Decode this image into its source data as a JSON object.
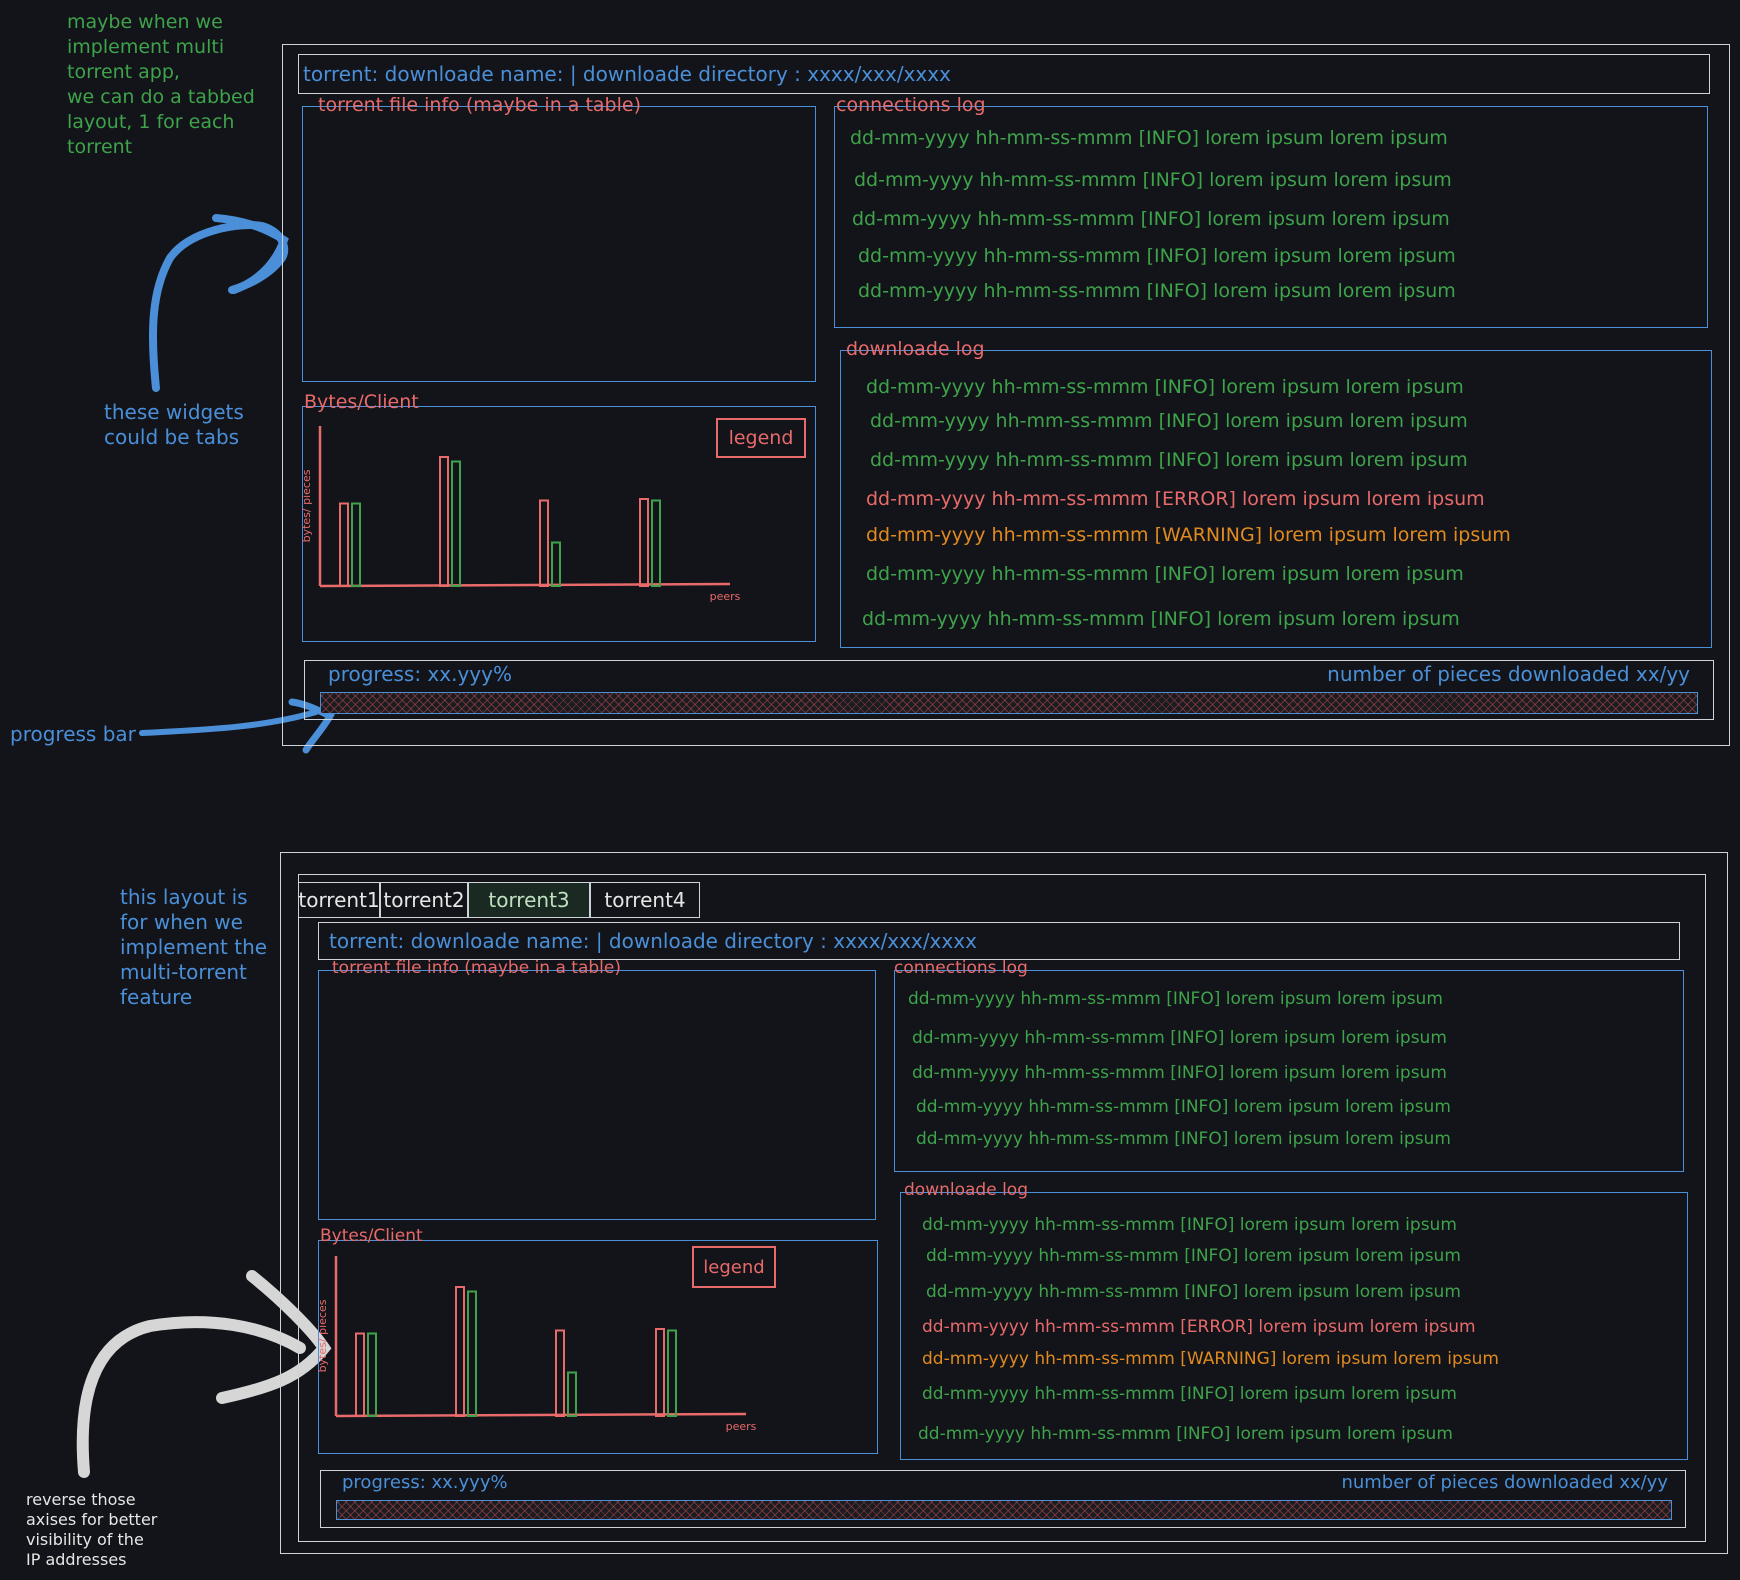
{
  "notes": {
    "top_left": "maybe when we\nimplement multi\ntorrent app,\nwe can do a tabbed\nlayout, 1 for each\ntorrent",
    "widgets_tabs": "these widgets\ncould be tabs",
    "progress_bar": "progress bar",
    "multi_layout": "this layout is\nfor when we\nimplement the\nmulti-torrent\nfeature",
    "reverse_axes": "reverse those\naxises for better\nvisibility of the\nIP addresses"
  },
  "header": {
    "text": "torrent: downloade name:  | downloade directory : xxxx/xxx/xxxx"
  },
  "widgets": {
    "file_info_title": "torrent file info (maybe in a table)",
    "connections_title": "connections log",
    "download_title": "downloade log",
    "chart_title": "Bytes/Client",
    "legend_label": "legend"
  },
  "connections_log": [
    "dd-mm-yyyy hh-mm-ss-mmm [INFO] lorem ipsum lorem ipsum",
    "dd-mm-yyyy hh-mm-ss-mmm [INFO] lorem ipsum lorem ipsum",
    "dd-mm-yyyy hh-mm-ss-mmm [INFO] lorem ipsum lorem ipsum",
    "dd-mm-yyyy hh-mm-ss-mmm [INFO] lorem ipsum lorem ipsum",
    "dd-mm-yyyy hh-mm-ss-mmm [INFO] lorem ipsum lorem ipsum"
  ],
  "download_log": [
    {
      "text": "dd-mm-yyyy hh-mm-ss-mmm [INFO] lorem ipsum lorem ipsum",
      "level": "info"
    },
    {
      "text": "dd-mm-yyyy hh-mm-ss-mmm [INFO] lorem ipsum lorem ipsum",
      "level": "info"
    },
    {
      "text": "dd-mm-yyyy hh-mm-ss-mmm [INFO] lorem ipsum lorem ipsum",
      "level": "info"
    },
    {
      "text": "dd-mm-yyyy hh-mm-ss-mmm [ERROR] lorem ipsum lorem ipsum",
      "level": "error"
    },
    {
      "text": "dd-mm-yyyy hh-mm-ss-mmm [WARNING] lorem ipsum lorem ipsum",
      "level": "warning"
    },
    {
      "text": "dd-mm-yyyy hh-mm-ss-mmm [INFO] lorem ipsum lorem ipsum",
      "level": "info"
    },
    {
      "text": "dd-mm-yyyy hh-mm-ss-mmm [INFO] lorem ipsum lorem ipsum",
      "level": "info"
    }
  ],
  "progress": {
    "label": "progress: xx.yyy%",
    "pieces": "number of pieces downloaded xx/yy"
  },
  "tabs": [
    "torrent1",
    "torrent2",
    "torrent3",
    "torrent4"
  ],
  "active_tab": "torrent3",
  "colors": {
    "background": "#121419",
    "frame": "#cfd2d6",
    "blue": "#4a8fd8",
    "red": "#e86a6a",
    "green": "#3ea34a",
    "orange": "#e08a1f"
  },
  "chart_data": {
    "type": "bar",
    "title": "Bytes/Client",
    "ylabel": "bytes/ pieces",
    "xlabel": "peers",
    "legend": "legend",
    "categories": [
      "",
      "",
      "",
      ""
    ],
    "series": [
      {
        "color": "#e86a6a",
        "values": [
          0.55,
          0.86,
          0.57,
          0.58
        ]
      },
      {
        "color": "#3ea34a",
        "values": [
          0.55,
          0.83,
          0.29,
          0.57
        ]
      }
    ],
    "ylim": [
      0,
      1
    ]
  }
}
